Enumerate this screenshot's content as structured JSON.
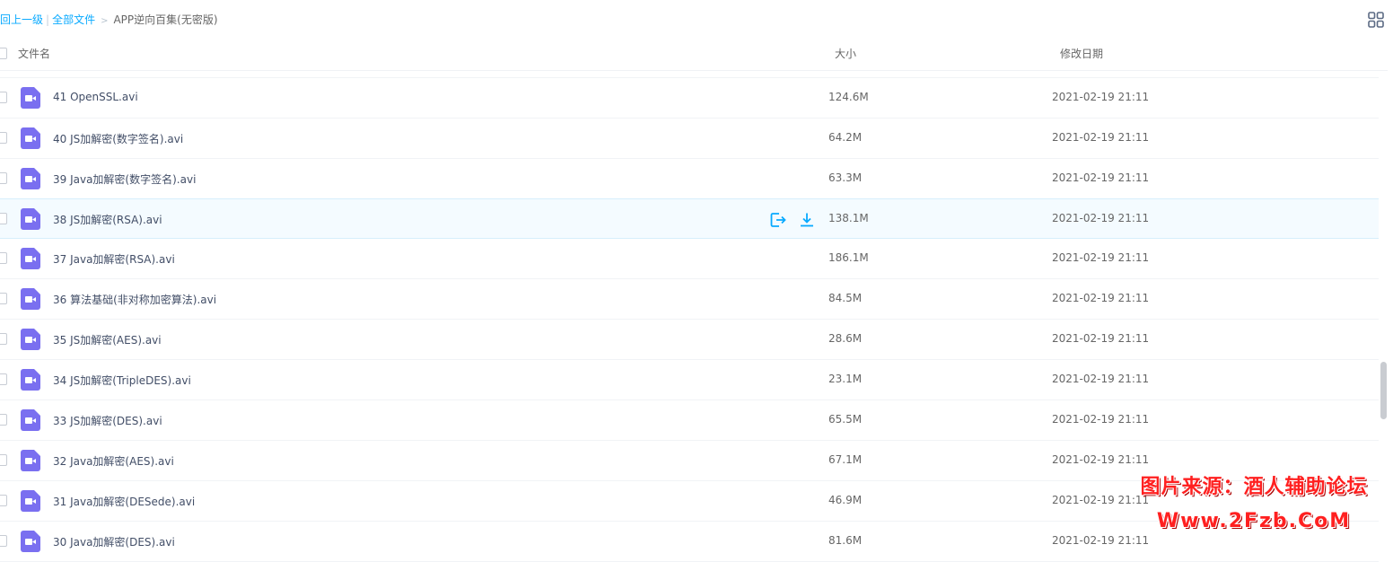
{
  "breadcrumb": {
    "back": "返回上一级",
    "all_files": "全部文件",
    "current": "APP逆向百集(无密版)"
  },
  "header": {
    "name": "文件名",
    "size": "大小",
    "date": "修改日期"
  },
  "icons": {
    "file": "video-file-icon",
    "file_color": "#7a6ff0",
    "share": "share-icon",
    "download": "download-icon",
    "view": "grid-view-icon",
    "action_color": "#09aaff"
  },
  "files": [
    {
      "name": "41 OpenSSL.avi",
      "size": "124.6M",
      "date": "2021-02-19 21:11"
    },
    {
      "name": "40 JS加解密(数字签名).avi",
      "size": "64.2M",
      "date": "2021-02-19 21:11"
    },
    {
      "name": "39 Java加解密(数字签名).avi",
      "size": "63.3M",
      "date": "2021-02-19 21:11"
    },
    {
      "name": "38 JS加解密(RSA).avi",
      "size": "138.1M",
      "date": "2021-02-19 21:11"
    },
    {
      "name": "37 Java加解密(RSA).avi",
      "size": "186.1M",
      "date": "2021-02-19 21:11"
    },
    {
      "name": "36 算法基础(非对称加密算法).avi",
      "size": "84.5M",
      "date": "2021-02-19 21:11"
    },
    {
      "name": "35 JS加解密(AES).avi",
      "size": "28.6M",
      "date": "2021-02-19 21:11"
    },
    {
      "name": "34 JS加解密(TripleDES).avi",
      "size": "23.1M",
      "date": "2021-02-19 21:11"
    },
    {
      "name": "33 JS加解密(DES).avi",
      "size": "65.5M",
      "date": "2021-02-19 21:11"
    },
    {
      "name": "32 Java加解密(AES).avi",
      "size": "67.1M",
      "date": "2021-02-19 21:11"
    },
    {
      "name": "31 Java加解密(DESede).avi",
      "size": "46.9M",
      "date": "2021-02-19 21:11"
    },
    {
      "name": "30 Java加解密(DES).avi",
      "size": "81.6M",
      "date": "2021-02-19 21:11"
    }
  ],
  "watermark": {
    "line1": "图片来源：酒人辅助论坛",
    "line2": "Www.2Fzb.CoM"
  }
}
